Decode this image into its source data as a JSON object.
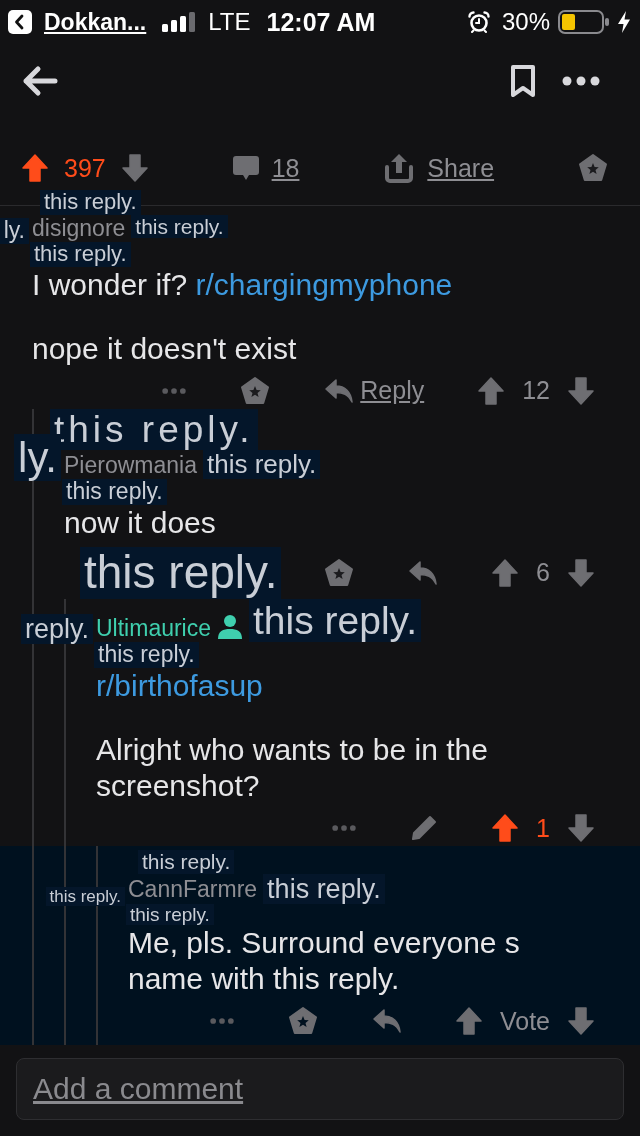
{
  "status_bar": {
    "back_app": "Dokkan...",
    "network": "LTE",
    "time": "12:07 AM",
    "battery": "30%"
  },
  "post_actions": {
    "upvoted": true,
    "score": "397",
    "comments": "18",
    "share": "Share"
  },
  "comments": [
    {
      "sticker_above": "this reply.",
      "sticker_before": "ly.",
      "author": "disignore",
      "op": false,
      "sticker_after": "this reply.",
      "sticker_below": "this reply.",
      "highlighted": false,
      "paragraphs": [
        [
          {
            "kind": "text",
            "text": "I wonder if?"
          },
          {
            "kind": "link",
            "text": "r/chargingmyphone"
          }
        ],
        [
          {
            "kind": "text",
            "text": "nope it doesn't exist"
          }
        ]
      ],
      "actions": [
        {
          "kind": "more"
        },
        {
          "kind": "award"
        },
        {
          "kind": "reply",
          "label": "Reply"
        },
        {
          "kind": "vote"
        }
      ],
      "upvoted": false,
      "score": "12",
      "children": [
        {
          "sticker_above": "this reply.",
          "sticker_before": "ly.",
          "author": "Pierowmania",
          "op": false,
          "sticker_after": "this reply.",
          "sticker_below": "this reply.",
          "highlighted": false,
          "paragraphs": [
            [
              {
                "kind": "text",
                "text": "now it does"
              }
            ]
          ],
          "sticker_actions": "this reply.",
          "actions": [
            {
              "kind": "award"
            },
            {
              "kind": "reply"
            },
            {
              "kind": "vote"
            }
          ],
          "upvoted": false,
          "score": "6",
          "children": [
            {
              "sticker_before": "reply.",
              "author": "Ultimaurice",
              "op": true,
              "sticker_after": "this reply.",
              "sticker_below": "this reply.",
              "highlighted": false,
              "paragraphs": [
                [
                  {
                    "kind": "link",
                    "text": "r/birthofasup"
                  }
                ],
                [
                  {
                    "kind": "text",
                    "text": "Alright who wants to be in the screenshot?"
                  }
                ]
              ],
              "actions": [
                {
                  "kind": "more"
                },
                {
                  "kind": "edit"
                },
                {
                  "kind": "vote"
                }
              ],
              "upvoted": true,
              "score": "1",
              "children": [
                {
                  "sticker_above": "this reply.",
                  "sticker_before": "this reply.",
                  "author": "CannFarmre",
                  "op": false,
                  "sticker_after": "this reply.",
                  "sticker_below": "this reply.",
                  "highlighted": true,
                  "paragraphs": [
                    [
                      {
                        "kind": "text",
                        "text": "Me, pls. Surround everyone s name with this reply."
                      }
                    ]
                  ],
                  "actions": [
                    {
                      "kind": "more"
                    },
                    {
                      "kind": "award"
                    },
                    {
                      "kind": "reply"
                    },
                    {
                      "kind": "vote"
                    }
                  ],
                  "upvoted": false,
                  "score": "Vote"
                }
              ]
            }
          ]
        }
      ]
    }
  ],
  "composer": {
    "placeholder": "Add a comment"
  }
}
